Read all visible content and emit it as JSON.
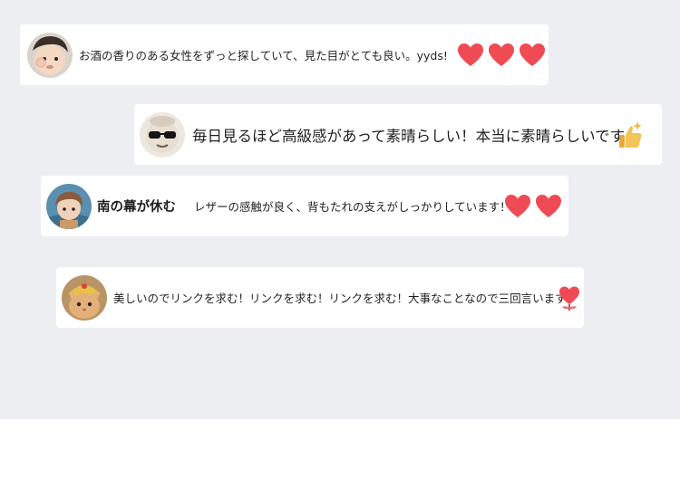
{
  "comments": [
    {
      "text": "お酒の香りのある女性をずっと探していて、見た目がとても良い。yyds!",
      "reaction_icons": [
        "heart-icon",
        "heart-icon",
        "heart-icon"
      ]
    },
    {
      "text": "毎日見るほど高級感があって素晴らしい！本当に素晴らしいです",
      "reaction_icons": [
        "thumbs-up-sparkle-icon"
      ]
    },
    {
      "author": "南の幕が休む",
      "text": "レザーの感触が良く、背もたれの支えがしっかりしています！",
      "reaction_icons": [
        "heart-icon",
        "heart-icon"
      ]
    },
    {
      "text": "美しいのでリンクを求む！リンクを求む！リンクを求む！大事なことなので三回言います",
      "reaction_icons": [
        "heart-flower-icon"
      ]
    }
  ],
  "colors": {
    "background": "#eceef1",
    "card": "#ffffff",
    "heart": "#f04a55",
    "thumb": "#f2c45a"
  }
}
